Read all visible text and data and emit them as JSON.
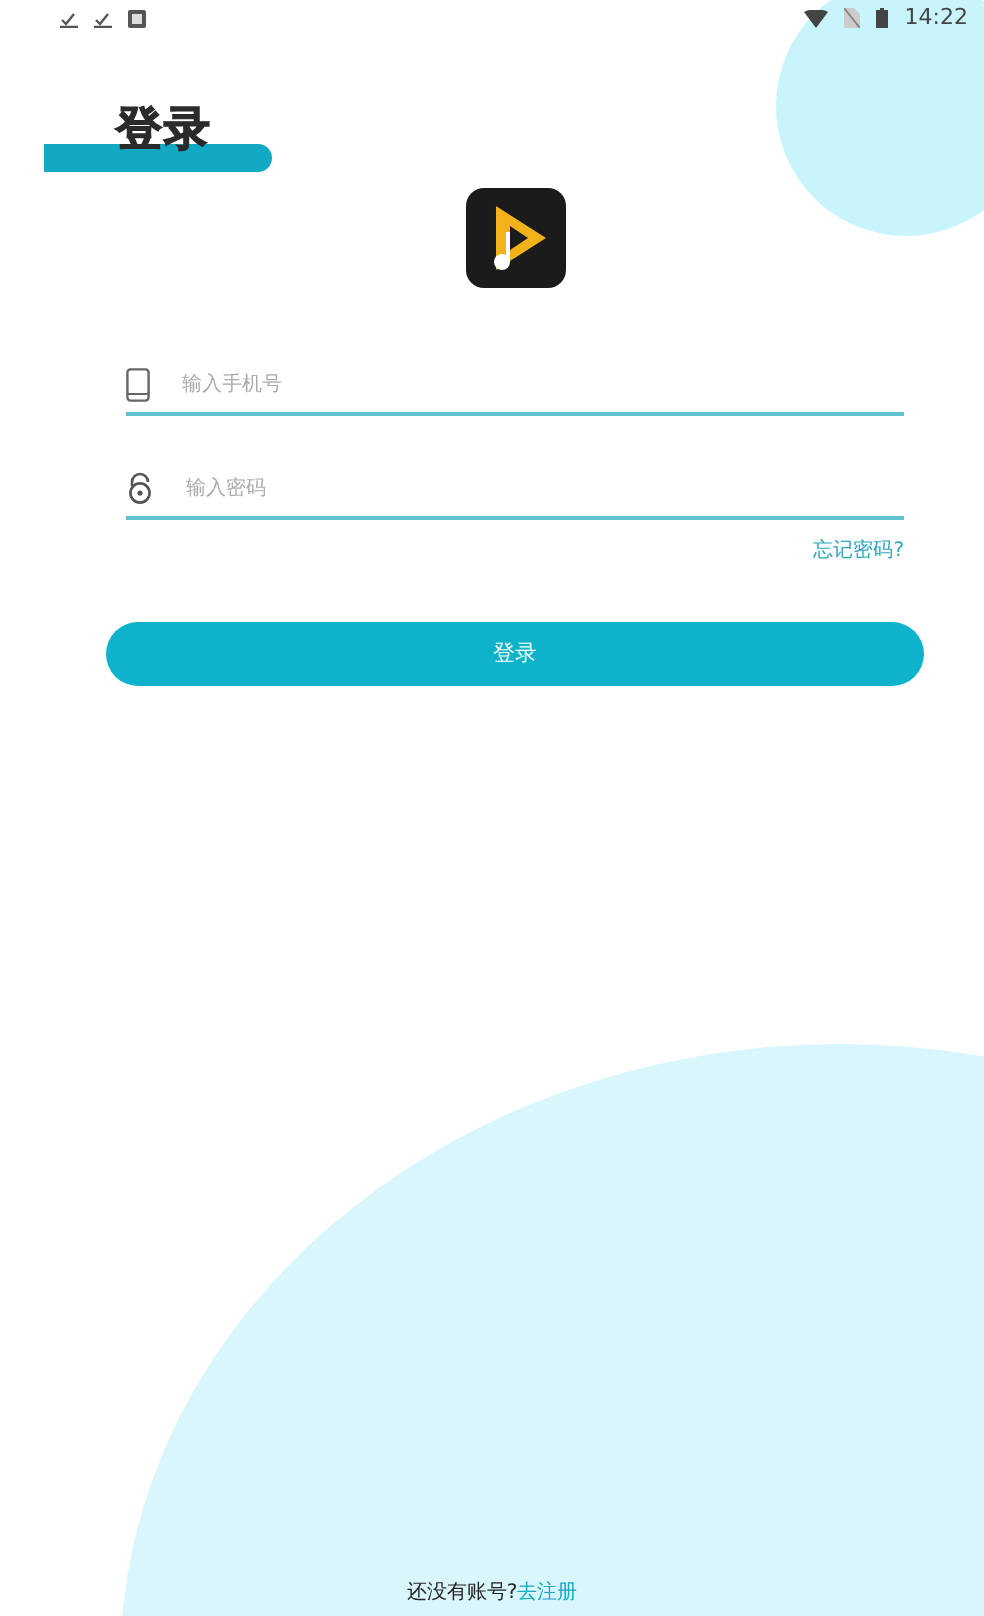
{
  "status_bar": {
    "time": "14:22"
  },
  "title": "登录",
  "fields": [
    {
      "kind": "phone",
      "placeholder": "输入手机号"
    },
    {
      "kind": "password",
      "placeholder": "输入密码"
    }
  ],
  "forgot_link": "忘记密码?",
  "login_button": "登录",
  "register": {
    "prompt": "还没有账号?",
    "link": "去注册"
  }
}
